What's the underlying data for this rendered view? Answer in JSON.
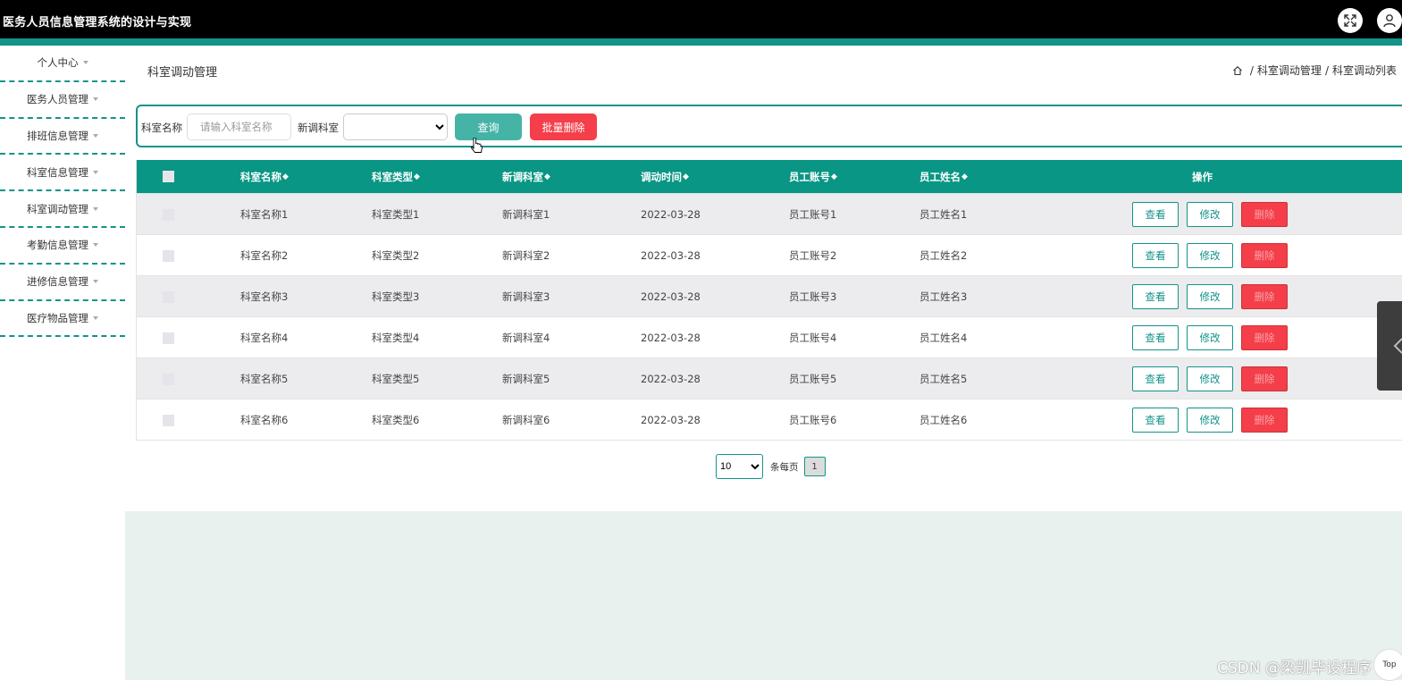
{
  "app": {
    "title": "医务人员信息管理系统的设计与实现"
  },
  "sidebar": {
    "items": [
      {
        "label": "个人中心"
      },
      {
        "label": "医务人员管理"
      },
      {
        "label": "排班信息管理"
      },
      {
        "label": "科室信息管理"
      },
      {
        "label": "科室调动管理"
      },
      {
        "label": "考勤信息管理"
      },
      {
        "label": "进修信息管理"
      },
      {
        "label": "医疗物品管理"
      }
    ]
  },
  "page": {
    "title": "科室调动管理",
    "breadcrumb": [
      "科室调动管理",
      "科室调动列表"
    ]
  },
  "search": {
    "name_label": "科室名称",
    "name_placeholder": "请输入科室名称",
    "new_dept_label": "新调科室",
    "new_dept_value": "",
    "query_label": "查询",
    "bulk_delete_label": "批量删除"
  },
  "table": {
    "columns": [
      "科室名称",
      "科室类型",
      "新调科室",
      "调动时间",
      "员工账号",
      "员工姓名",
      "操作"
    ],
    "sort_icon": "◆",
    "rows": [
      {
        "name": "科室名称1",
        "type": "科室类型1",
        "new_dept": "新调科室1",
        "time": "2022-03-28",
        "account": "员工账号1",
        "staff": "员工姓名1"
      },
      {
        "name": "科室名称2",
        "type": "科室类型2",
        "new_dept": "新调科室2",
        "time": "2022-03-28",
        "account": "员工账号2",
        "staff": "员工姓名2"
      },
      {
        "name": "科室名称3",
        "type": "科室类型3",
        "new_dept": "新调科室3",
        "time": "2022-03-28",
        "account": "员工账号3",
        "staff": "员工姓名3"
      },
      {
        "name": "科室名称4",
        "type": "科室类型4",
        "new_dept": "新调科室4",
        "time": "2022-03-28",
        "account": "员工账号4",
        "staff": "员工姓名4"
      },
      {
        "name": "科室名称5",
        "type": "科室类型5",
        "new_dept": "新调科室5",
        "time": "2022-03-28",
        "account": "员工账号5",
        "staff": "员工姓名5"
      },
      {
        "name": "科室名称6",
        "type": "科室类型6",
        "new_dept": "新调科室6",
        "time": "2022-03-28",
        "account": "员工账号6",
        "staff": "员工姓名6"
      }
    ],
    "actions": {
      "view": "查看",
      "edit": "修改",
      "delete": "删除"
    }
  },
  "pager": {
    "page_size": "10",
    "per_page_label": "条每页",
    "current_page": "1"
  },
  "watermark": "CSDN @梁凯毕设程序",
  "top_button": "Top",
  "colors": {
    "teal": "#13948a",
    "header_teal": "#099684",
    "danger": "#f43e4a",
    "query": "#45b4a6"
  }
}
